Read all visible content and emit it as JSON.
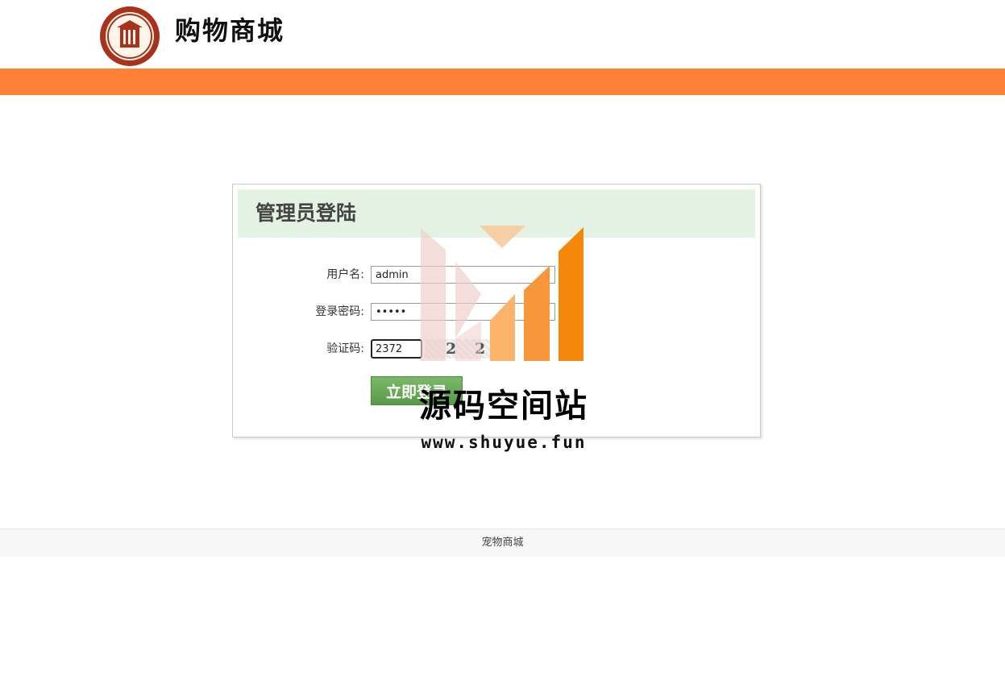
{
  "header": {
    "site_title": "购物商城",
    "logo": "seal-logo-icon"
  },
  "colors": {
    "orange_bar": "#ff8135",
    "login_head": "#e4f2e4",
    "login_button": "#6aaa57"
  },
  "login": {
    "title": "管理员登陆",
    "username_label": "用户名:",
    "username_value": "admin",
    "password_label": "登录密码:",
    "password_value": "admin",
    "captcha_label": "验证码:",
    "captcha_value": "2372",
    "captcha_image_text": "2 2",
    "submit_label": "立即登录"
  },
  "watermark": {
    "name": "源码空间站",
    "url": "www.shuyue.fun",
    "icon": "bar-chart-logo-icon"
  },
  "footer": {
    "text": "宠物商城"
  }
}
